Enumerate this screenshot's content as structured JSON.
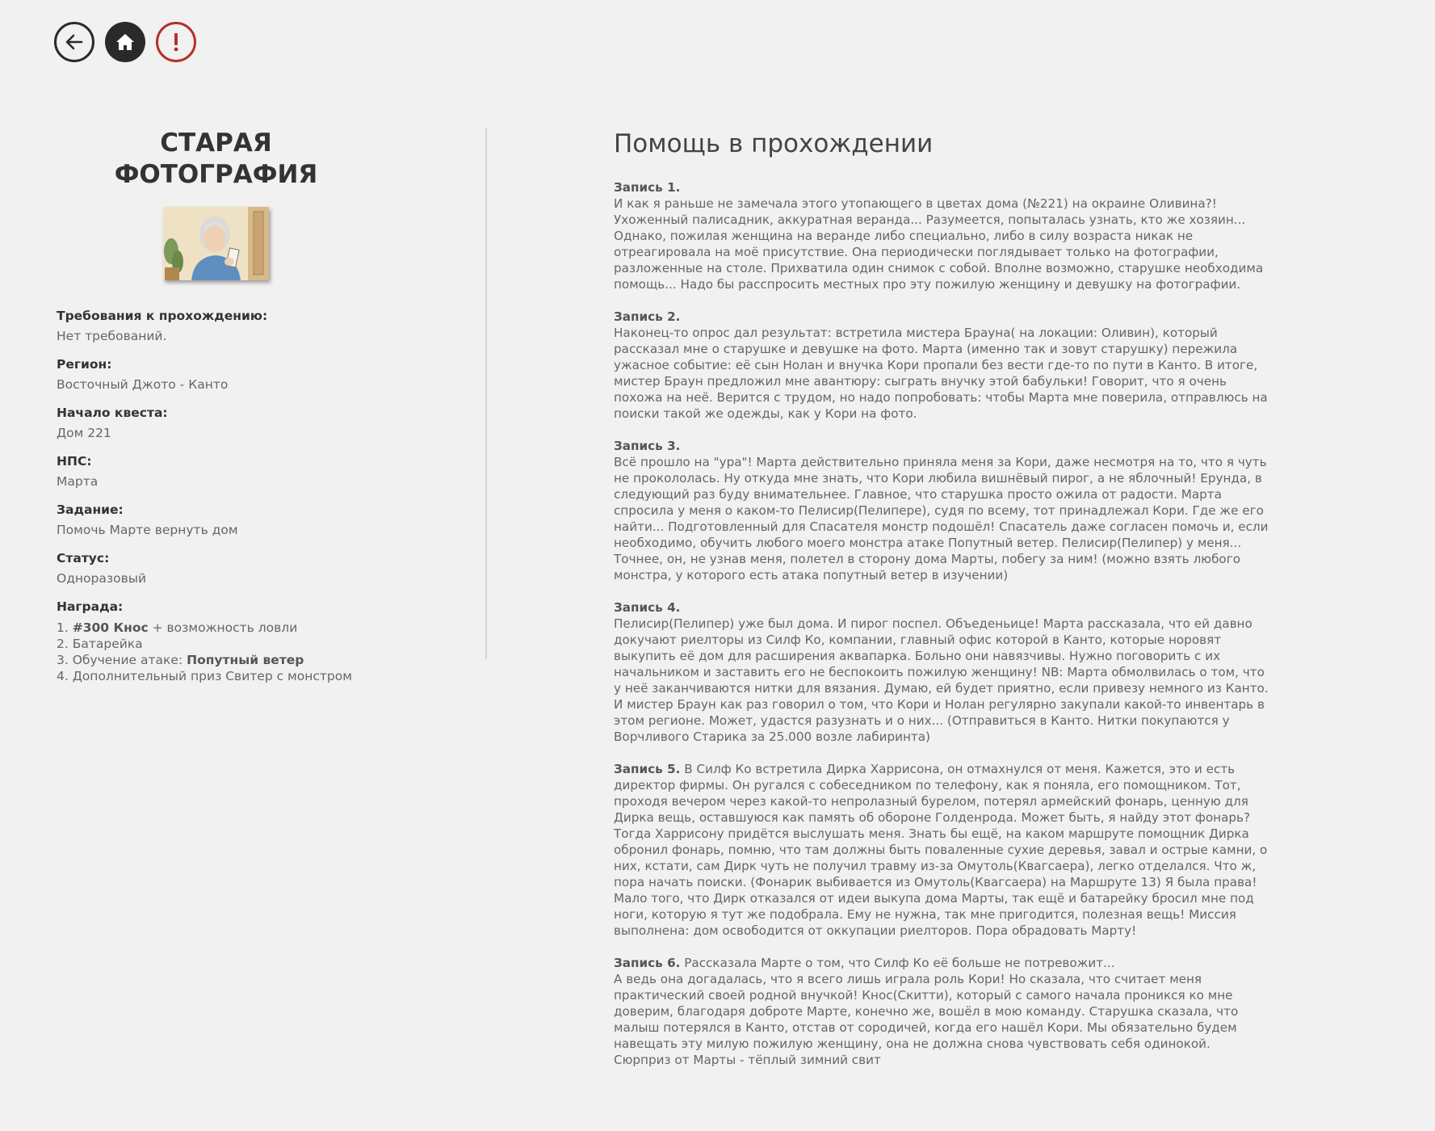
{
  "nav": {
    "back_icon": "arrow-left-icon",
    "home_icon": "home-icon",
    "alert_icon": "exclamation-icon",
    "colors": {
      "dark": "#2a2a2a",
      "alert": "#b3312b"
    }
  },
  "quest": {
    "title_line1": "СТАРАЯ",
    "title_line2": "ФОТОГРАФИЯ",
    "image_icon": "old-woman-portrait",
    "fields": [
      {
        "label": "Требования к прохождению:",
        "value": "Нет требований."
      },
      {
        "label": "Регион:",
        "value": "Восточный Джото - Канто"
      },
      {
        "label": "Начало квеста:",
        "value": "Дом 221"
      },
      {
        "label": "НПС:",
        "value": "Марта"
      },
      {
        "label": "Задание:",
        "value": "Помочь Марте вернуть дом"
      },
      {
        "label": "Статус:",
        "value": "Одноразовый"
      }
    ],
    "reward_label": "Награда:",
    "rewards": [
      {
        "prefix": "1. ",
        "bold": "#300 Кнос",
        "suffix": " + возможность ловли"
      },
      {
        "prefix": "2.  Батарейка",
        "bold": "",
        "suffix": ""
      },
      {
        "prefix": "3. Обучение атаке: ",
        "bold": "Попутный ветер",
        "suffix": ""
      },
      {
        "prefix": "4. Дополнительный приз  Свитер с монстром",
        "bold": "",
        "suffix": ""
      }
    ]
  },
  "help": {
    "title": "Помощь в прохождении",
    "entries": [
      {
        "header": "Запись 1.",
        "inline": false,
        "text": "И как я раньше не замечала этого утопающего в цветах дома (№221) на окраине Оливина?! Ухоженный палисадник, аккуратная веранда... Разумеется, попыталась узнать, кто же хозяин... Однако, пожилая женщина на веранде либо специально, либо в силу возраста никак не отреагировала на моё присутствие. Она периодически поглядывает только на фотографии, разложенные на столе. Прихватила один снимок с собой. Вполне возможно, старушке необходима помощь... Надо бы расспросить местных про эту пожилую женщину и девушку на фотографии."
      },
      {
        "header": "Запись 2.",
        "inline": false,
        "text": "Наконец-то опрос дал результат: встретила мистера Брауна( на локации: Оливин), который рассказал мне о старушке и девушке на фото. Марта (именно так и зовут старушку) пережила ужасное событие: её сын Нолан и внучка Кори пропали без вести где-то по пути в Канто. В итоге, мистер Браун предложил мне авантюру: сыграть внучку этой бабульки! Говорит, что я очень похожа на неё. Верится с трудом, но надо попробовать: чтобы Марта мне поверила, отправлюсь на поиски такой же одежды, как у Кори на фото."
      },
      {
        "header": "Запись 3.",
        "inline": false,
        "text": "Всё прошло на \"ура\"! Марта действительно приняла меня за Кори, даже несмотря на то, что я чуть не прокололась. Ну откуда мне знать, что Кори любила вишнёвый пирог, а не яблочный! Ерунда, в следующий раз буду внимательнее. Главное, что старушка просто ожила от радости. Марта спросила у меня о каком-то Пелисир(Пелипере), судя по всему, тот принадлежал Кори. Где же его найти... Подготовленный для Спасателя монстр подошёл! Спасатель даже согласен помочь и, если необходимо, обучить любого моего монстра атаке Попутный ветер. Пелисир(Пелипер) у меня... Точнее, он, не узнав меня, полетел в сторону дома Марты, побегу за ним! (можно взять любого монстра, у которого есть атака попутный ветер в изучении)"
      },
      {
        "header": "Запись 4.",
        "inline": false,
        "text": "Пелисир(Пелипер) уже был дома. И пирог поспел. Объеденьице! Марта рассказала, что ей давно докучают риелторы из Силф Ко, компании, главный офис которой в Канто, которые норовят выкупить её дом для расширения аквапарка. Больно они навязчивы. Нужно поговорить с их начальником и заставить его не беспокоить пожилую женщину! NB: Марта обмолвилась о том, что у неё заканчиваются нитки для вязания. Думаю, ей будет приятно, если привезу немного из Канто. И мистер Браун как раз говорил о том, что Кори и Нолан регулярно закупали какой-то инвентарь в этом регионе. Может, удастся разузнать и о них... (Отправиться в Канто. Нитки покупаются у Ворчливого Старика за 25.000 возле лабиринта)"
      },
      {
        "header": "Запись 5.",
        "inline": true,
        "text": "В Силф Ко встретила Дирка Харрисона, он отмахнулся от меня. Кажется, это и есть директор фирмы. Он ругался с собеседником по телефону, как я поняла, его помощником. Тот, проходя вечером через какой-то непролазный бурелом, потерял армейский фонарь, ценную для Дирка вещь, оставшуюся как память об обороне Голденрода. Может быть, я найду этот фонарь? Тогда Харрисону придётся выслушать меня. Знать бы ещё, на каком маршруте помощник Дирка обронил фонарь, помню, что там должны быть поваленные сухие деревья, завал и острые камни, о них, кстати, сам Дирк чуть не получил травму из-за Омутоль(Квагсаера), легко отделался. Что ж, пора начать поиски. (Фонарик выбивается из Омутоль(Квагсаера) на Маршруте 13) Я была права! Мало того, что Дирк отказался от идеи выкупа дома Марты, так ещё и батарейку бросил мне под ноги, которую я тут же подобрала. Ему не нужна, так мне пригодится, полезная вещь! Миссия выполнена: дом освободится от оккупации риелторов. Пора обрадовать Марту!"
      },
      {
        "header": "Запись 6.",
        "inline": true,
        "text": "Рассказала Марте о том, что Силф Ко её больше не потревожит...",
        "text2": "А ведь она догадалась, что я всего лишь играла роль Кори! Но сказала, что считает меня практический своей родной внучкой! Кнос(Скитти), который с самого начала проникся ко мне доверим, благодаря доброте Марте, конечно же, вошёл в мою команду. Старушка сказала, что малыш потерялся в Канто, отстав от сородичей, когда его нашёл Кори. Мы обязательно будем навещать эту милую пожилую женщину, она не должна снова чувствовать себя одинокой. Сюрприз от Марты - тёплый зимний свит"
      }
    ]
  }
}
